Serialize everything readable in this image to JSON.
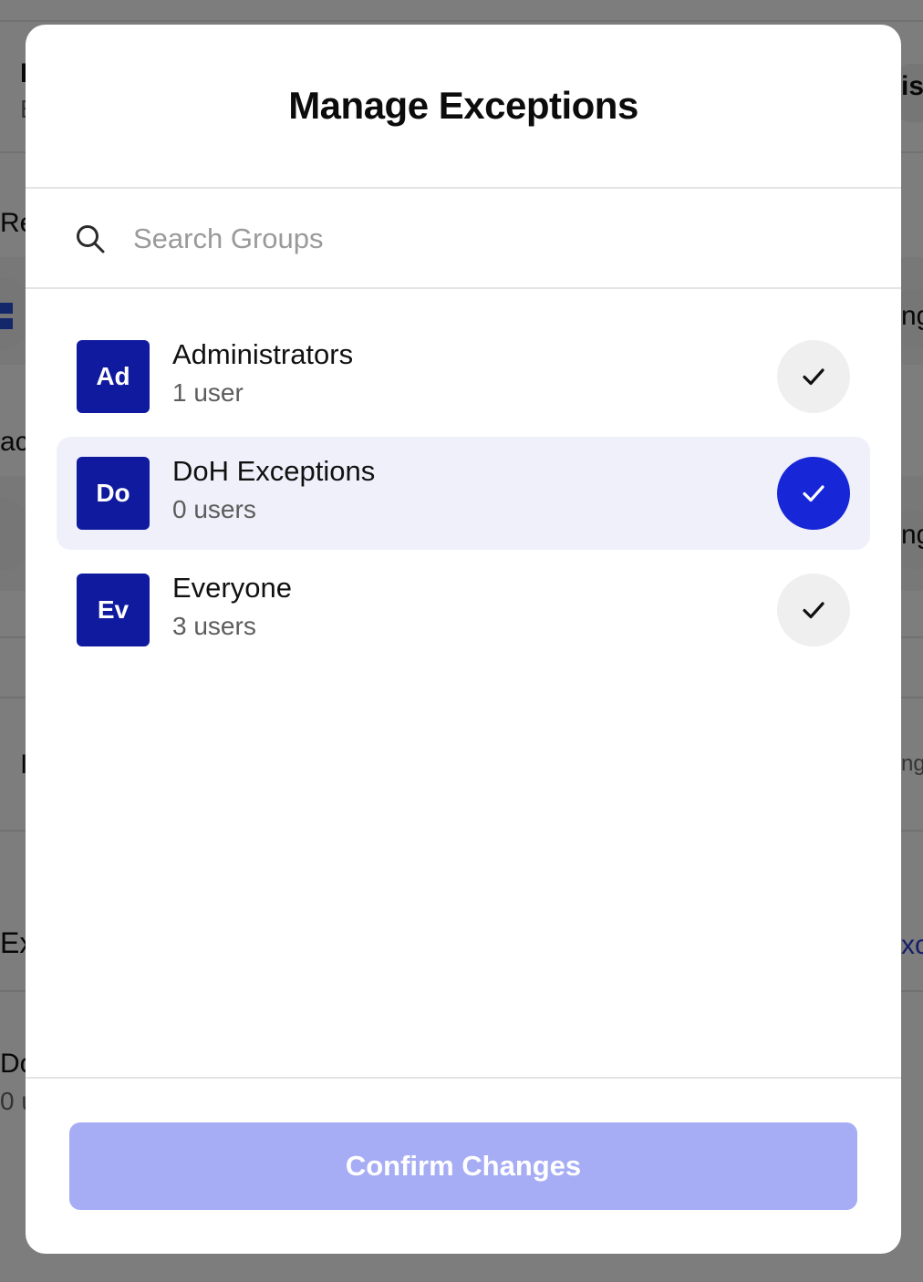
{
  "background": {
    "fragments_left": [
      "I",
      "E",
      "Re",
      "ac",
      "I",
      "Ex",
      "Do",
      "0 u"
    ],
    "fragments_right": [
      "is",
      "ng",
      "ng",
      "ng",
      "xc"
    ]
  },
  "modal": {
    "title": "Manage Exceptions",
    "search": {
      "placeholder": "Search Groups",
      "value": ""
    },
    "groups": [
      {
        "initials": "Ad",
        "name": "Administrators",
        "count": "1 user",
        "selected": false
      },
      {
        "initials": "Do",
        "name": "DoH Exceptions",
        "count": "0 users",
        "selected": true
      },
      {
        "initials": "Ev",
        "name": "Everyone",
        "count": "3 users",
        "selected": false
      }
    ],
    "confirm_label": "Confirm Changes"
  },
  "colors": {
    "avatar": "#0f1a9e",
    "selected_check": "#1726d6",
    "selected_row": "#eff0fa",
    "confirm_disabled": "#a6adf5"
  },
  "icons": {
    "search": "search-icon",
    "check": "check-icon"
  }
}
